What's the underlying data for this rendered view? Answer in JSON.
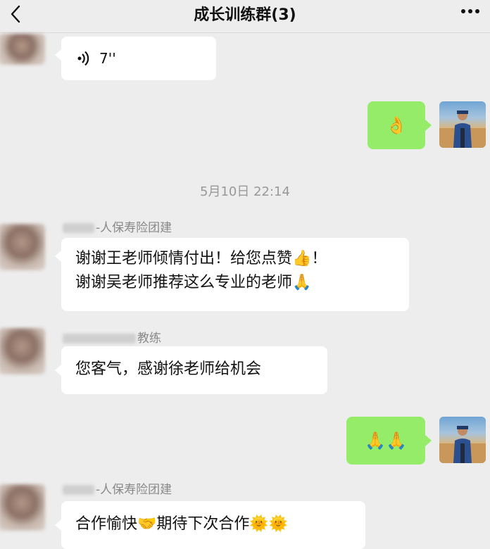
{
  "header": {
    "title": "成长训练群(3)"
  },
  "messages": {
    "voice": {
      "duration": "7''"
    },
    "ok_reply": {
      "emoji": "👌"
    },
    "timestamp": "5月10日 22:14",
    "msg1": {
      "sender": "-人保寿险团建",
      "line1": "谢谢王老师倾情付出！给您点赞👍！",
      "line2": "谢谢吴老师推荐这么专业的老师🙏"
    },
    "msg2": {
      "sender": "教练",
      "text": "您客气，感谢徐老师给机会"
    },
    "pray_reply": {
      "emoji": "🙏🙏"
    },
    "msg3": {
      "sender": "-人保寿险团建",
      "text": "合作愉快🤝期待下次合作🌞🌞"
    }
  },
  "colors": {
    "background": "#ededed",
    "outgoing": "#95ec69",
    "incoming": "#ffffff"
  }
}
